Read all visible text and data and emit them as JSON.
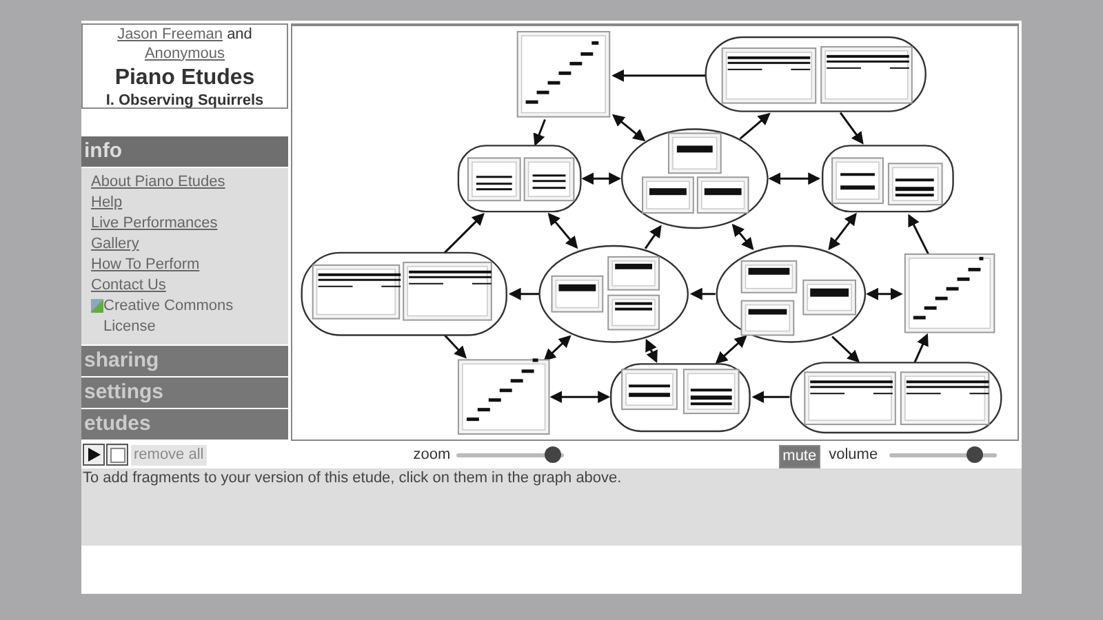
{
  "header": {
    "authors": [
      {
        "name": "Jason Freeman"
      },
      {
        "name": "Anonymous"
      }
    ],
    "conjunction": "and",
    "title": "Piano Etudes",
    "subtitle": "I. Observing Squirrels"
  },
  "sidebar": {
    "sections": [
      {
        "title": "info",
        "expanded": true,
        "links": [
          "About Piano Etudes",
          "Help",
          "Live Performances",
          "Gallery",
          "How To Perform",
          "Contact Us"
        ],
        "image_alt": "Creative Commons License"
      },
      {
        "title": "sharing",
        "expanded": false
      },
      {
        "title": "settings",
        "expanded": false
      },
      {
        "title": "etudes",
        "expanded": false
      }
    ]
  },
  "controls": {
    "remove_all": {
      "label": "remove all",
      "disabled": true
    },
    "zoom": {
      "label": "zoom",
      "level": 0.9
    },
    "mute": {
      "label": "mute"
    },
    "volume": {
      "label": "volume",
      "level": 0.8
    }
  },
  "message": "To add fragments to your version of this etude, click on them in the graph above."
}
